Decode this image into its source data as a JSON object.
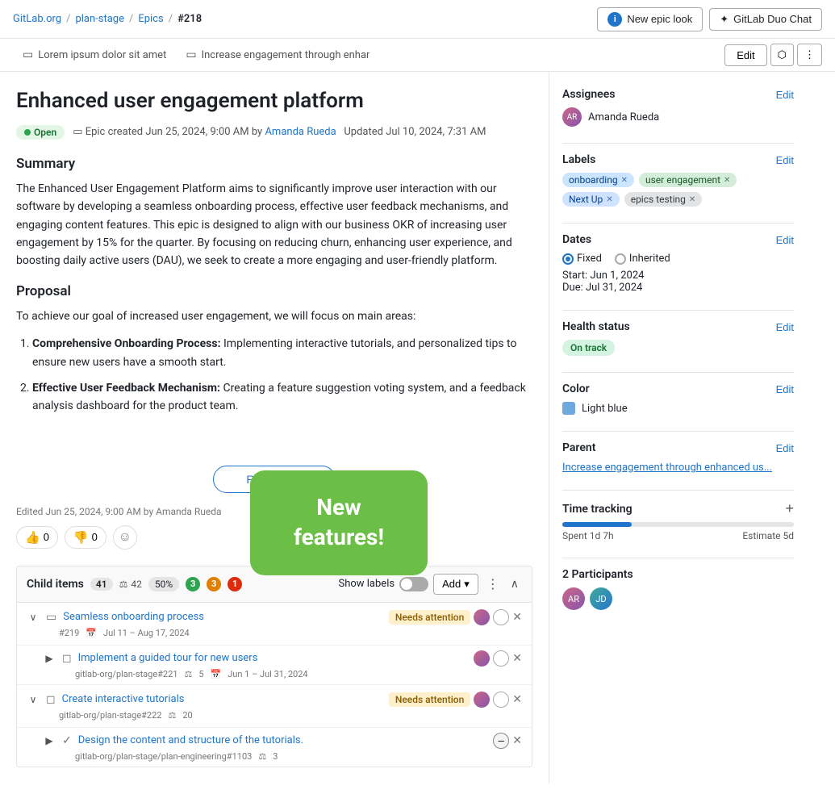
{
  "nav": {
    "org": "GitLab.org",
    "section": "plan-stage",
    "epics": "Epics",
    "issue_num": "#218",
    "new_epic_label": "New epic look",
    "duo_chat_label": "GitLab Duo Chat"
  },
  "tabs": [
    {
      "label": "Lorem ipsum dolor sit amet"
    },
    {
      "label": "Increase engagement through enhanced user experienc..."
    }
  ],
  "toolbar": {
    "edit_label": "Edit",
    "share_icon": "⬡",
    "more_icon": "⋮"
  },
  "epic": {
    "title": "Enhanced user engagement platform",
    "status": "Open",
    "created": "Epic created Jun 25, 2024, 9:00 AM by",
    "author": "Amanda Rueda",
    "updated": "Updated Jul 10, 2024, 7:31 AM"
  },
  "summary": {
    "heading": "Summary",
    "text": "The Enhanced User Engagement Platform aims to significantly improve user interaction with our software by developing a seamless onboarding process, effective user feedback mechanisms, and engaging content features. This epic is designed to align with our business OKR of increasing user engagement by 15% for the quarter. By focusing on reducing churn, enhancing user experience, and boosting daily active users (DAU), we seek to create a more engaging and user-friendly platform."
  },
  "proposal": {
    "heading": "Proposal",
    "intro": "To achieve our goal of increased user engagement, we will focus on main areas:",
    "items": [
      {
        "title": "Comprehensive Onboarding Process:",
        "text": "Implementing interactive tutorials, and personalized tips to ensure new users have a smooth start."
      },
      {
        "title": "Effective User Feedback Mechanism:",
        "text": "Creating a feature suggestion voting system, and a feedback analysis dashboard for the product team."
      }
    ]
  },
  "read_more": "Read more",
  "edited": "Edited Jun 25, 2024, 9:00 AM by Amanda Rueda",
  "reactions": {
    "thumbs_up": "👍",
    "thumbs_up_count": "0",
    "thumbs_down": "👎",
    "thumbs_down_count": "0"
  },
  "overlay": {
    "line1": "New",
    "line2": "features!"
  },
  "child_items": {
    "label": "Child items",
    "count": "41",
    "weight": "42",
    "progress": "50%",
    "dot_green": "3",
    "dot_orange": "3",
    "dot_red": "1",
    "show_labels": "Show labels",
    "add_label": "Add",
    "items": [
      {
        "type": "epic",
        "title": "Seamless onboarding process",
        "id": "#219",
        "date": "Jul 11 – Aug 17, 2024",
        "status_badge": "Needs attention",
        "expanded": true,
        "children": []
      },
      {
        "type": "issue",
        "title": "Implement a guided tour for new users",
        "ref": "gitlab-org/plan-stage#221",
        "weight": "5",
        "date": "Jun 1 – Jul 31, 2024",
        "expanded": false,
        "children": []
      },
      {
        "type": "issue",
        "title": "Create interactive tutorials",
        "ref": "gitlab-org/plan-stage#222",
        "weight": "20",
        "status_badge": "Needs attention",
        "expanded": true,
        "children": []
      },
      {
        "type": "task",
        "title": "Design the content and structure of the tutorials.",
        "ref": "gitlab-org/plan-stage/plan-engineering#1103",
        "weight": "3",
        "expanded": false,
        "children": []
      }
    ]
  },
  "sidebar": {
    "assignees_label": "Assignees",
    "assignee_name": "Amanda Rueda",
    "labels_label": "Labels",
    "labels": [
      {
        "name": "onboarding",
        "style": "onboarding"
      },
      {
        "name": "user engagement",
        "style": "user-engagement"
      },
      {
        "name": "Next Up",
        "style": "next-up"
      },
      {
        "name": "epics testing",
        "style": "epics-testing"
      }
    ],
    "dates_label": "Dates",
    "fixed_label": "Fixed",
    "inherited_label": "Inherited",
    "start_date": "Start: Jun 1, 2024",
    "due_date": "Due: Jul 31, 2024",
    "health_label": "Health status",
    "health_value": "On track",
    "color_label": "Color",
    "color_value": "Light blue",
    "parent_label": "Parent",
    "parent_value": "Increase engagement through enhanced us...",
    "time_tracking_label": "Time tracking",
    "time_spent": "Spent 1d 7h",
    "time_estimate": "Estimate 5d",
    "participants_label": "2 Participants",
    "edit_label": "Edit"
  }
}
